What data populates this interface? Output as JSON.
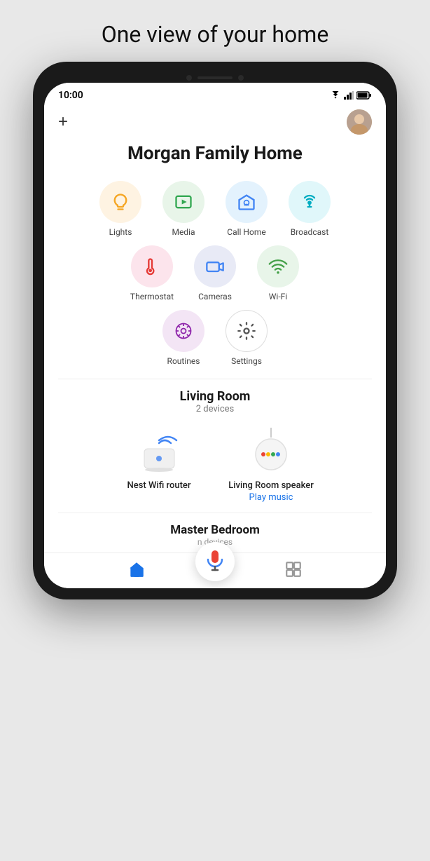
{
  "page": {
    "hero_title": "One view of your home"
  },
  "status_bar": {
    "time": "10:00",
    "wifi_icon": "wifi",
    "signal_icon": "signal",
    "battery_icon": "battery"
  },
  "header": {
    "add_label": "+",
    "home_title": "Morgan Family Home"
  },
  "icon_grid": {
    "row1": [
      {
        "id": "lights",
        "label": "Lights",
        "bg": "bg-yellow",
        "color": "#f5a623"
      },
      {
        "id": "media",
        "label": "Media",
        "bg": "bg-green",
        "color": "#34a853"
      },
      {
        "id": "call-home",
        "label": "Call Home",
        "bg": "bg-blue",
        "color": "#4285f4"
      },
      {
        "id": "broadcast",
        "label": "Broadcast",
        "bg": "bg-cyan",
        "color": "#00acc1"
      }
    ],
    "row2": [
      {
        "id": "thermostat",
        "label": "Thermostat",
        "bg": "bg-red",
        "color": "#e53935"
      },
      {
        "id": "cameras",
        "label": "Cameras",
        "bg": "bg-blue2",
        "color": "#3f51b5"
      },
      {
        "id": "wifi",
        "label": "Wi-Fi",
        "bg": "bg-green2",
        "color": "#43a047"
      }
    ],
    "row3": [
      {
        "id": "routines",
        "label": "Routines",
        "bg": "bg-purple",
        "color": "#8e24aa"
      },
      {
        "id": "settings",
        "label": "Settings",
        "bg": "bg-white-border",
        "color": "#555"
      }
    ]
  },
  "living_room": {
    "title": "Living Room",
    "subtitle": "2 devices",
    "devices": [
      {
        "id": "nest-wifi",
        "label": "Nest Wifi router",
        "action": null
      },
      {
        "id": "living-room-speaker",
        "label": "Living Room speaker",
        "action": "Play music"
      }
    ]
  },
  "master_room": {
    "title": "Master Bedroom",
    "subtitle": "n devices"
  },
  "bottom_nav": {
    "home_label": "home",
    "menu_label": "menu"
  }
}
